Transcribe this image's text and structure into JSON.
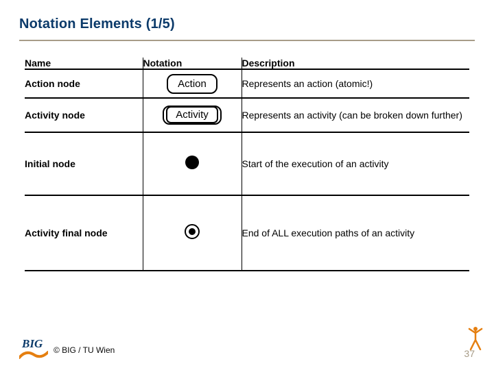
{
  "slide": {
    "title": "Notation Elements (1/5)",
    "page_number": "37"
  },
  "table": {
    "headers": {
      "name": "Name",
      "notation": "Notation",
      "description": "Description"
    },
    "rows": [
      {
        "name": "Action node",
        "notation_type": "action",
        "notation_label": "Action",
        "description": "Represents an action (atomic!)"
      },
      {
        "name": "Activity node",
        "notation_type": "activity",
        "notation_label": "Activity",
        "description": "Represents an activity (can be broken down further)"
      },
      {
        "name": "Initial node",
        "notation_type": "initial",
        "notation_label": "",
        "description": "Start of the execution of an activity"
      },
      {
        "name": "Activity final node",
        "notation_type": "final",
        "notation_label": "",
        "description": "End of ALL execution paths of an activity"
      }
    ]
  },
  "footer": {
    "logo_text": "BIG",
    "copyright": "© BIG / TU Wien"
  },
  "colors": {
    "title": "#0b3a6a",
    "underline": "#a79c88",
    "page_number": "#a79c88",
    "logo_orange": "#e57f10"
  }
}
